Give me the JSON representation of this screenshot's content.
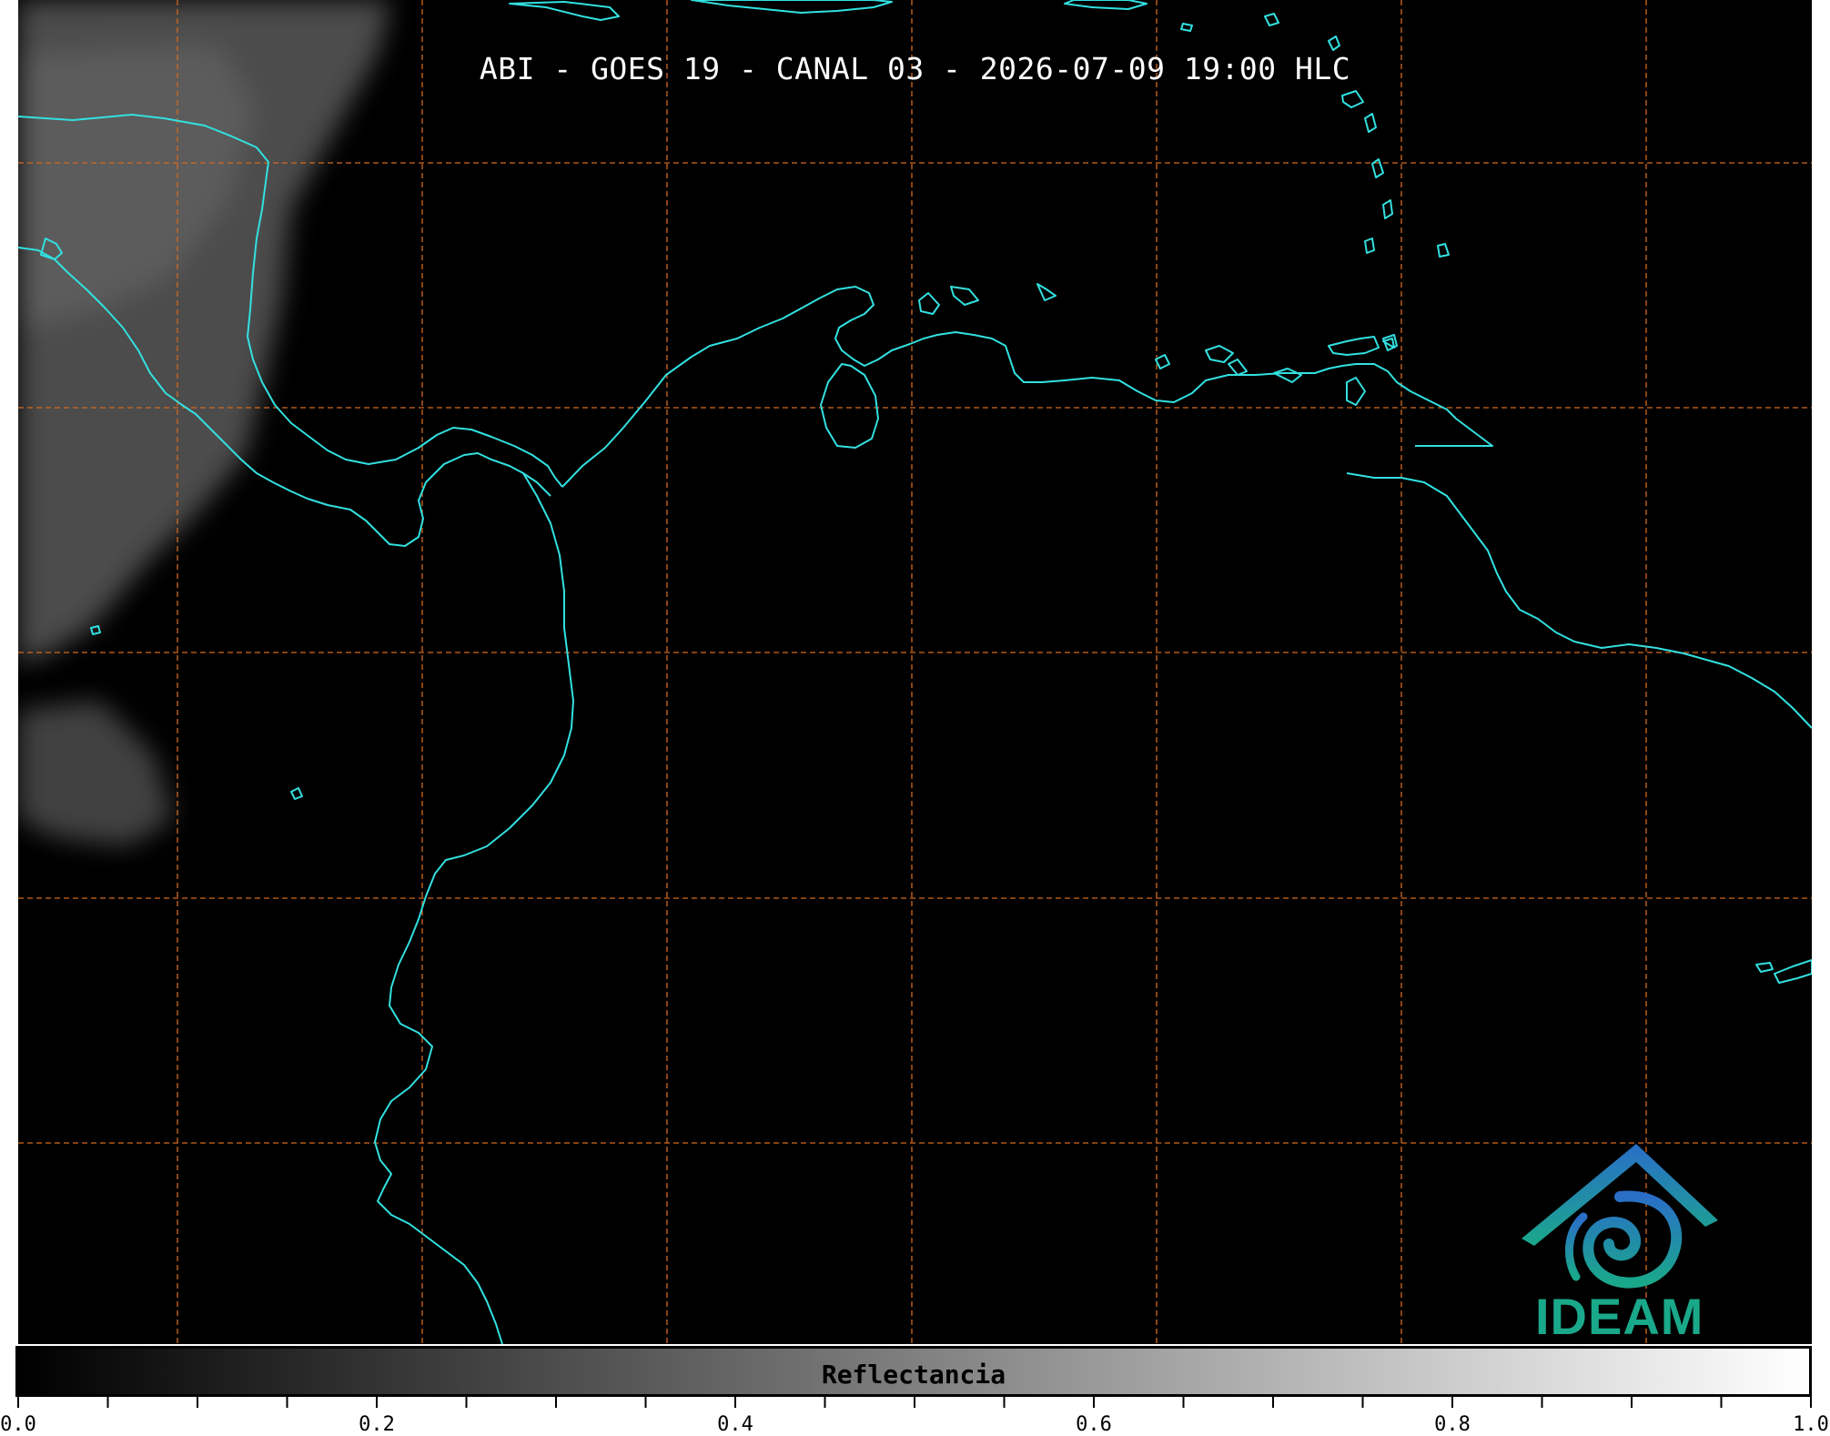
{
  "map": {
    "title": "ABI - GOES 19 - CANAL 03 - 2026-07-09 19:00 HLC",
    "background_color": "#000000",
    "coastline_color": "#33e0e0",
    "gridline_color": "#d2691e",
    "cloud_tint": "#8a8a8a"
  },
  "colorbar": {
    "label": "Reflectancia",
    "range": [
      0.0,
      1.0
    ],
    "colormap": "gray",
    "ticks": [
      {
        "value": 0.0,
        "label": "0.0"
      },
      {
        "value": 0.2,
        "label": "0.2"
      },
      {
        "value": 0.4,
        "label": "0.4"
      },
      {
        "value": 0.6,
        "label": "0.6"
      },
      {
        "value": 0.8,
        "label": "0.8"
      },
      {
        "value": 1.0,
        "label": "1.0"
      }
    ],
    "minor_tick_step": 0.05
  },
  "logo": {
    "name": "IDEAM",
    "text": "IDEAM",
    "color": "#1aa88a"
  }
}
